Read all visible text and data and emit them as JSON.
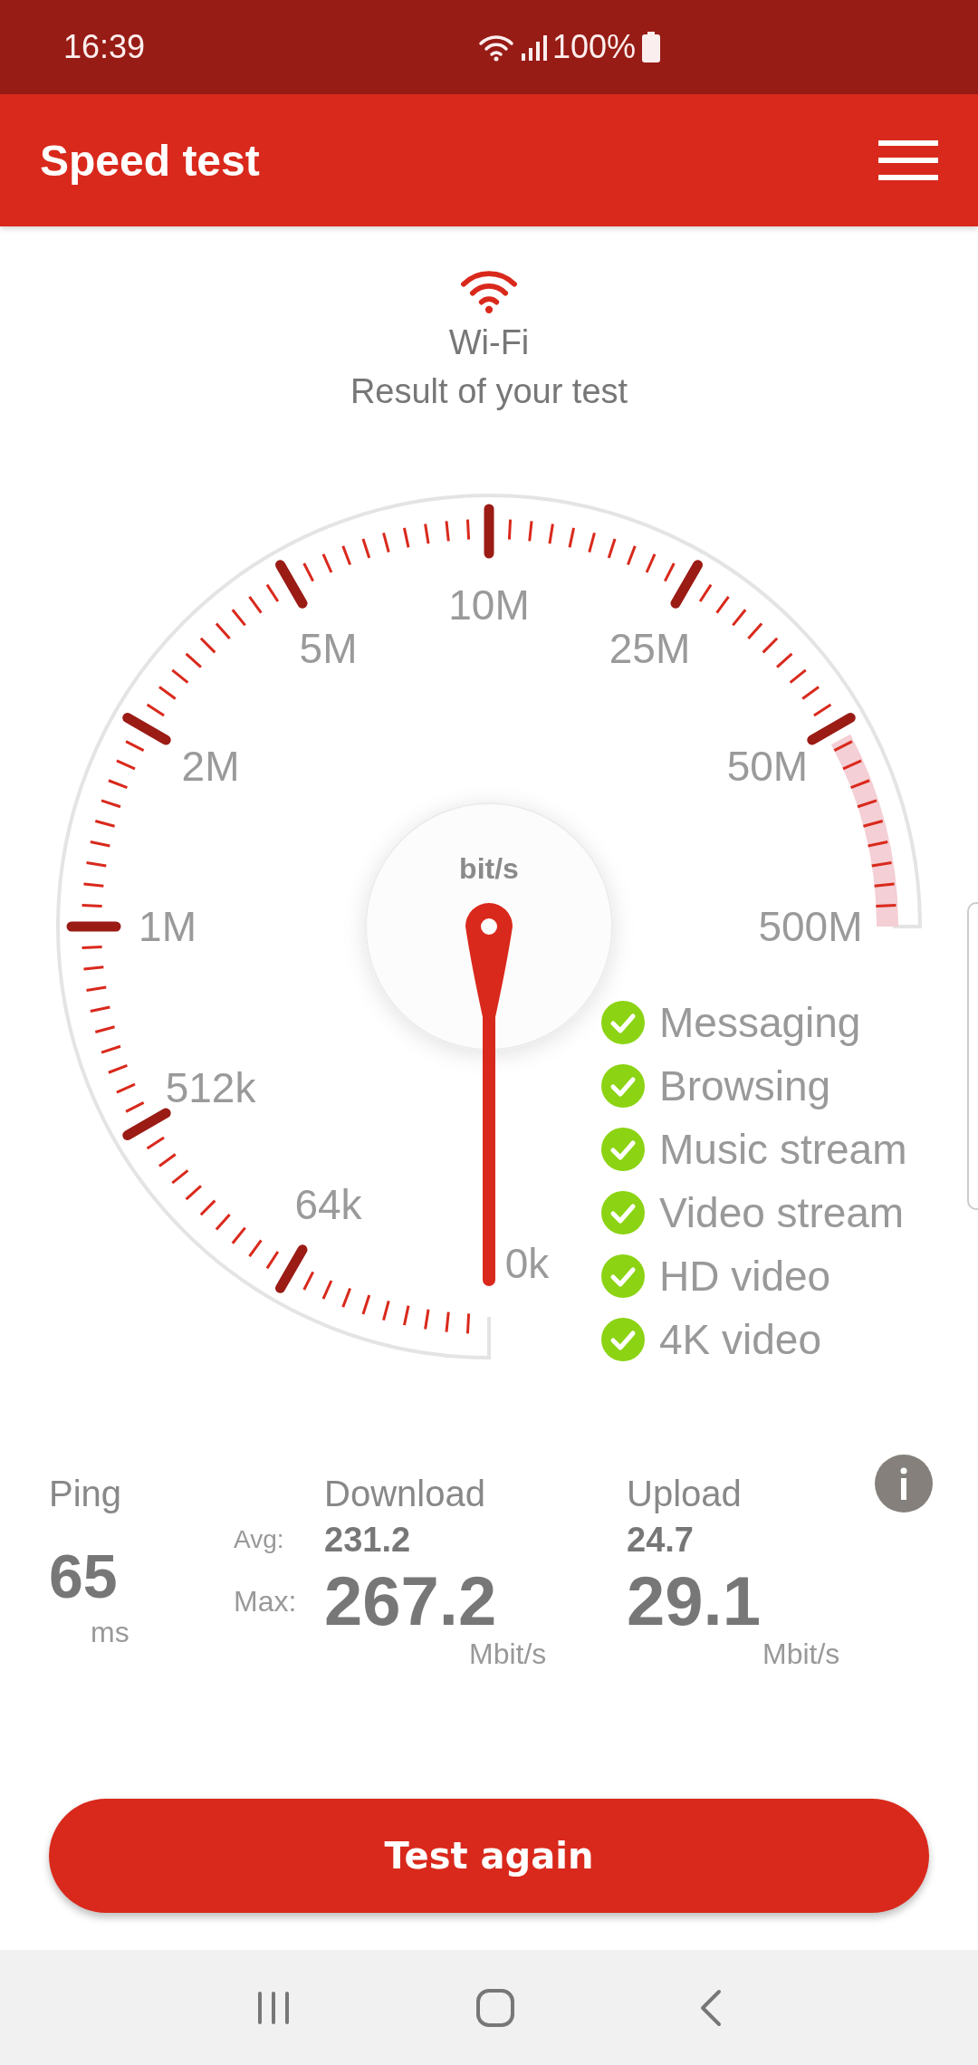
{
  "status_bar": {
    "time": "16:39",
    "battery": "100%"
  },
  "app_bar": {
    "title": "Speed test"
  },
  "connection": {
    "type": "Wi-Fi",
    "subtitle": "Result of your test"
  },
  "gauge": {
    "unit": "bit/s",
    "scale_labels": [
      "0k",
      "64k",
      "512k",
      "1M",
      "2M",
      "5M",
      "10M",
      "25M",
      "50M",
      "500M"
    ]
  },
  "services": [
    {
      "label": "Messaging",
      "checked": true
    },
    {
      "label": "Browsing",
      "checked": true
    },
    {
      "label": "Music stream",
      "checked": true
    },
    {
      "label": "Video stream",
      "checked": true
    },
    {
      "label": "HD video",
      "checked": true
    },
    {
      "label": "4K video",
      "checked": true
    }
  ],
  "results": {
    "ping": {
      "label": "Ping",
      "value": "65",
      "unit": "ms"
    },
    "avg_label": "Avg:",
    "max_label": "Max:",
    "download": {
      "label": "Download",
      "avg": "231.2",
      "max": "267.2",
      "unit": "Mbit/s"
    },
    "upload": {
      "label": "Upload",
      "avg": "24.7",
      "max": "29.1",
      "unit": "Mbit/s"
    }
  },
  "button": "Test again"
}
